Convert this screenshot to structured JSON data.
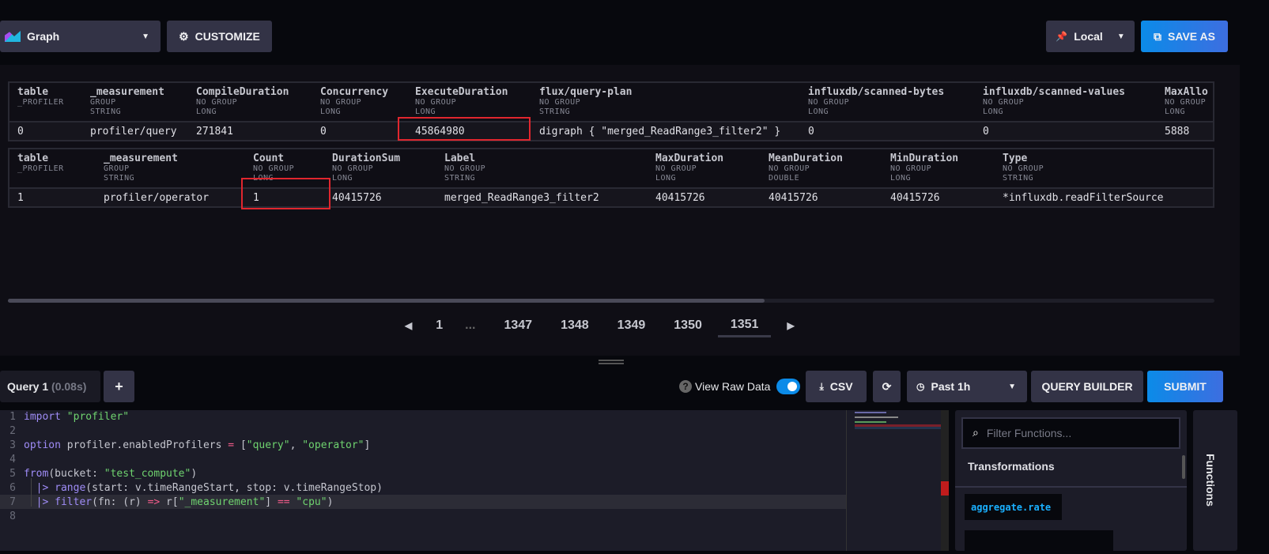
{
  "toolbar": {
    "graph_label": "Graph",
    "customize_label": "CUSTOMIZE",
    "local_label": "Local",
    "save_as_label": "SAVE AS"
  },
  "table1": {
    "headers": [
      {
        "name": "table",
        "group": "_PROFILER",
        "type": ""
      },
      {
        "name": "_measurement",
        "group": "GROUP",
        "type": "STRING"
      },
      {
        "name": "CompileDuration",
        "group": "NO GROUP",
        "type": "LONG"
      },
      {
        "name": "Concurrency",
        "group": "NO GROUP",
        "type": "LONG"
      },
      {
        "name": "ExecuteDuration",
        "group": "NO GROUP",
        "type": "LONG"
      },
      {
        "name": "flux/query-plan",
        "group": "NO GROUP",
        "type": "STRING"
      },
      {
        "name": "influxdb/scanned-bytes",
        "group": "NO GROUP",
        "type": "LONG"
      },
      {
        "name": "influxdb/scanned-values",
        "group": "NO GROUP",
        "type": "LONG"
      },
      {
        "name": "MaxAllo",
        "group": "NO GROUP",
        "type": "LONG"
      }
    ],
    "row": [
      "0",
      "profiler/query",
      "271841",
      "0",
      "45864980",
      "digraph { \"merged_ReadRange3_filter2\" }",
      "0",
      "0",
      "5888"
    ]
  },
  "table2": {
    "headers": [
      {
        "name": "table",
        "group": "_PROFILER",
        "type": ""
      },
      {
        "name": "_measurement",
        "group": "GROUP",
        "type": "STRING"
      },
      {
        "name": "Count",
        "group": "NO GROUP",
        "type": "LONG"
      },
      {
        "name": "DurationSum",
        "group": "NO GROUP",
        "type": "LONG"
      },
      {
        "name": "Label",
        "group": "NO GROUP",
        "type": "STRING"
      },
      {
        "name": "MaxDuration",
        "group": "NO GROUP",
        "type": "LONG"
      },
      {
        "name": "MeanDuration",
        "group": "NO GROUP",
        "type": "DOUBLE"
      },
      {
        "name": "MinDuration",
        "group": "NO GROUP",
        "type": "LONG"
      },
      {
        "name": "Type",
        "group": "NO GROUP",
        "type": "STRING"
      }
    ],
    "row": [
      "1",
      "profiler/operator",
      "1",
      "40415726",
      "merged_ReadRange3_filter2",
      "40415726",
      "40415726",
      "40415726",
      "*influxdb.readFilterSource"
    ]
  },
  "pagination": {
    "pages": [
      "1",
      "...",
      "1347",
      "1348",
      "1349",
      "1350",
      "1351"
    ],
    "current": "1351"
  },
  "query_bar": {
    "tab_label": "Query 1",
    "tab_time": "(0.08s)",
    "add_label": "+",
    "view_raw_label": "View Raw Data",
    "view_raw_on": true,
    "csv_label": "CSV",
    "time_range": "Past 1h",
    "query_builder_label": "QUERY BUILDER",
    "submit_label": "SUBMIT"
  },
  "editor": {
    "lines": [
      [
        {
          "t": "import ",
          "c": "#9f8cf7"
        },
        {
          "t": "\"profiler\"",
          "c": "#6fd36f"
        }
      ],
      [],
      [
        {
          "t": "option ",
          "c": "#9f8cf7"
        },
        {
          "t": "profiler.enabledProfilers ",
          "c": "#c5c6cf"
        },
        {
          "t": "= ",
          "c": "#f25b8a"
        },
        {
          "t": "[",
          "c": "#c5c6cf"
        },
        {
          "t": "\"query\"",
          "c": "#6fd36f"
        },
        {
          "t": ", ",
          "c": "#c5c6cf"
        },
        {
          "t": "\"operator\"",
          "c": "#6fd36f"
        },
        {
          "t": "]",
          "c": "#c5c6cf"
        }
      ],
      [],
      [
        {
          "t": "from",
          "c": "#9f8cf7"
        },
        {
          "t": "(bucket: ",
          "c": "#c5c6cf"
        },
        {
          "t": "\"test_compute\"",
          "c": "#6fd36f"
        },
        {
          "t": ")",
          "c": "#c5c6cf"
        }
      ],
      [
        {
          "t": "  |> ",
          "c": "#9f8cf7"
        },
        {
          "t": "range",
          "c": "#9f8cf7"
        },
        {
          "t": "(start: v.timeRangeStart, stop: v.timeRangeStop)",
          "c": "#c5c6cf"
        }
      ],
      [
        {
          "t": "  |> ",
          "c": "#9f8cf7"
        },
        {
          "t": "filter",
          "c": "#9f8cf7"
        },
        {
          "t": "(fn: (r) ",
          "c": "#c5c6cf"
        },
        {
          "t": "=> ",
          "c": "#f25b8a"
        },
        {
          "t": "r[",
          "c": "#c5c6cf"
        },
        {
          "t": "\"_measurement\"",
          "c": "#6fd36f"
        },
        {
          "t": "] ",
          "c": "#c5c6cf"
        },
        {
          "t": "== ",
          "c": "#f25b8a"
        },
        {
          "t": "\"cpu\"",
          "c": "#6fd36f"
        },
        {
          "t": ")",
          "c": "#c5c6cf"
        }
      ],
      []
    ]
  },
  "functions": {
    "search_placeholder": "Filter Functions...",
    "category": "Transformations",
    "items": [
      "aggregate.rate"
    ],
    "tab_label": "Functions"
  },
  "colors": {
    "accent": "#0b87e8",
    "highlight": "#e0262e",
    "background": "#07080d"
  }
}
